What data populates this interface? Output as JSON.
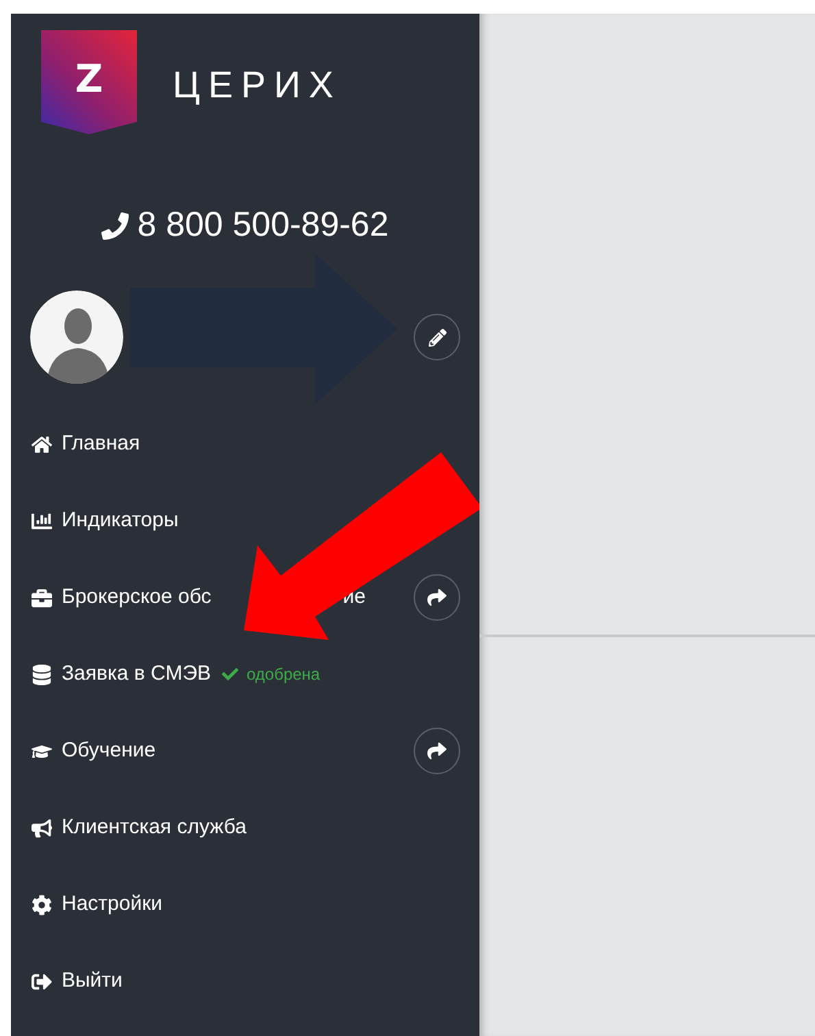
{
  "logo": {
    "mark": "Z",
    "name": "ЦЕРИХ"
  },
  "phone": "8 800 500-89-62",
  "menu": [
    {
      "label": "Главная",
      "has_share": false
    },
    {
      "label": "Индикаторы",
      "has_share": false
    },
    {
      "label": "Брокерское обс",
      "label_end": "ие",
      "has_share": true
    },
    {
      "label": "Заявка в СМЭВ",
      "status": "одобрена",
      "has_share": false
    },
    {
      "label": "Обучение",
      "has_share": true
    },
    {
      "label": "Клиентская служба",
      "has_share": false
    },
    {
      "label": "Настройки",
      "has_share": false
    },
    {
      "label": "Выйти",
      "has_share": false
    }
  ]
}
